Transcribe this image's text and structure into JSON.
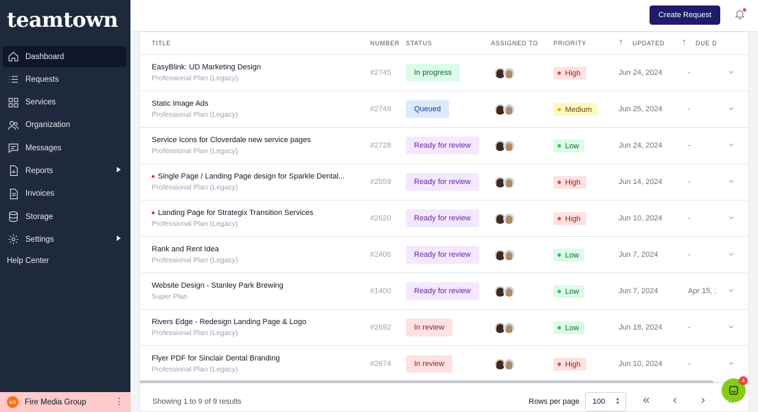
{
  "app": {
    "logo": "teamtown"
  },
  "sidebar": {
    "items": [
      {
        "label": "Dashboard",
        "icon": "home-icon",
        "active": true
      },
      {
        "label": "Requests",
        "icon": "list-icon"
      },
      {
        "label": "Services",
        "icon": "grid-icon"
      },
      {
        "label": "Organization",
        "icon": "users-icon"
      },
      {
        "label": "Messages",
        "icon": "message-icon"
      },
      {
        "label": "Reports",
        "icon": "report-icon",
        "submenu": true
      },
      {
        "label": "Invoices",
        "icon": "invoice-icon"
      },
      {
        "label": "Storage",
        "icon": "database-icon"
      },
      {
        "label": "Settings",
        "icon": "gear-icon",
        "submenu": true
      }
    ],
    "help": "Help Center",
    "org": "Fire Media Group"
  },
  "header": {
    "create_label": "Create Request"
  },
  "table": {
    "columns": {
      "title": "TITLE",
      "number": "NUMBER",
      "status": "STATUS",
      "assigned": "ASSIGNED TO",
      "priority": "PRIORITY",
      "updated": "UPDATED",
      "due": "DUE D"
    },
    "rows": [
      {
        "title": "EasyBlink: UD Marketing Design",
        "plan": "Professional Plan (Legacy)",
        "number": "#2745",
        "status": "In progress",
        "priority": "High",
        "updated": "Jun 24, 2024",
        "due": "-",
        "flag": false
      },
      {
        "title": "Static Image Ads",
        "plan": "Professional Plan (Legacy)",
        "number": "#2749",
        "status": "Queued",
        "priority": "Medium",
        "updated": "Jun 25, 2024",
        "due": "-",
        "flag": false
      },
      {
        "title": "Service Icons for Cloverdale new service pages",
        "plan": "Professional Plan (Legacy)",
        "number": "#2728",
        "status": "Ready for review",
        "priority": "Low",
        "updated": "Jun 24, 2024",
        "due": "-",
        "flag": false
      },
      {
        "title": "Single Page / Landing Page design for Sparkle Dental...",
        "plan": "Professional Plan (Legacy)",
        "number": "#2559",
        "status": "Ready for review",
        "priority": "High",
        "updated": "Jun 14, 2024",
        "due": "-",
        "flag": true
      },
      {
        "title": "Landing Page for Strategix Transition Services",
        "plan": "Professional Plan (Legacy)",
        "number": "#2620",
        "status": "Ready for review",
        "priority": "High",
        "updated": "Jun 10, 2024",
        "due": "-",
        "flag": true
      },
      {
        "title": "Rank and Rent Idea",
        "plan": "Professional Plan (Legacy)",
        "number": "#2406",
        "status": "Ready for review",
        "priority": "Low",
        "updated": "Jun 7, 2024",
        "due": "-",
        "flag": false
      },
      {
        "title": "Website Design - Stanley Park Brewing",
        "plan": "Super Plan",
        "number": "#1400",
        "status": "Ready for review",
        "priority": "Low",
        "updated": "Jun 7, 2024",
        "due": "Apr 15, 2",
        "flag": false
      },
      {
        "title": "Rivers Edge - Redesign Landing Page & Logo",
        "plan": "Professional Plan (Legacy)",
        "number": "#2692",
        "status": "In review",
        "priority": "Low",
        "updated": "Jun 18, 2024",
        "due": "-",
        "flag": false
      },
      {
        "title": "Flyer PDF for Sinclair Dental Branding",
        "plan": "Professional Plan (Legacy)",
        "number": "#2674",
        "status": "In review",
        "priority": "High",
        "updated": "Jun 10, 2024",
        "due": "-",
        "flag": false
      }
    ]
  },
  "footer": {
    "results": "Showing 1 to 9 of 9 results",
    "rows_label": "Rows per page",
    "rows_value": "100"
  },
  "chat": {
    "badge": "4"
  },
  "colors": {
    "sidebar_bg": "#1e293b",
    "primary_button": "#1e1b6b",
    "status": {
      "In progress": {
        "bg": "#dcfce7",
        "fg": "#166534"
      },
      "Queued": {
        "bg": "#dbeafe",
        "fg": "#1e3a8a"
      },
      "Ready for review": {
        "bg": "#f3e8ff",
        "fg": "#6b21a8"
      },
      "In review": {
        "bg": "#fee2e2",
        "fg": "#991b1b"
      }
    },
    "priority": {
      "High": {
        "bg": "#fee2e2",
        "fg": "#991b1b",
        "dot": "#ef4444"
      },
      "Medium": {
        "bg": "#fef9c3",
        "fg": "#713f12",
        "dot": "#eab308"
      },
      "Low": {
        "bg": "#dcfce7",
        "fg": "#166534",
        "dot": "#22c55e"
      }
    }
  }
}
